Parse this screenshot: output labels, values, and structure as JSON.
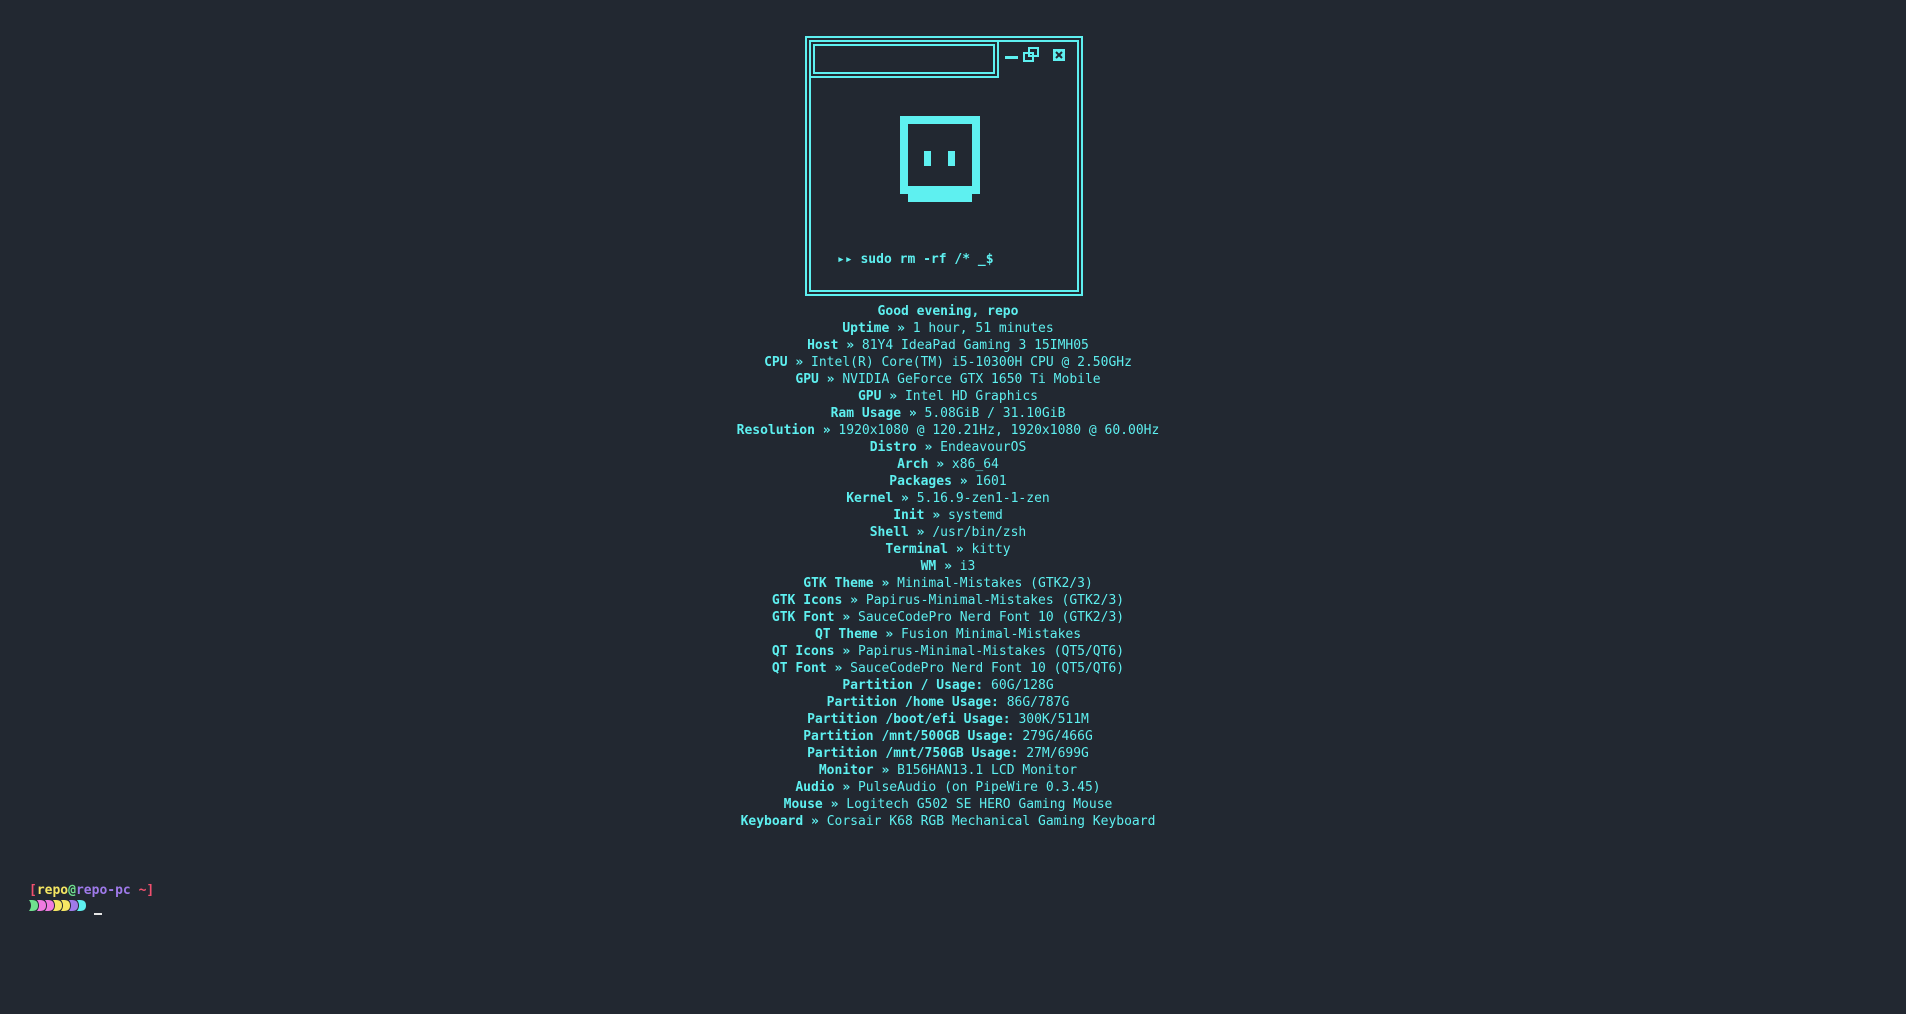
{
  "logo": {
    "command": "▸▸ sudo rm -rf /* _$"
  },
  "greeting": "Good evening, repo",
  "info": [
    {
      "key": "Uptime",
      "sep": " » ",
      "value": "1 hour, 51 minutes"
    },
    {
      "key": "Host",
      "sep": " » ",
      "value": "81Y4 IdeaPad Gaming 3 15IMH05"
    },
    {
      "key": "CPU",
      "sep": " » ",
      "value": "Intel(R) Core(TM) i5-10300H CPU @ 2.50GHz"
    },
    {
      "key": "GPU",
      "sep": " » ",
      "value": "NVIDIA GeForce GTX 1650 Ti Mobile"
    },
    {
      "key": "GPU",
      "sep": " » ",
      "value": "Intel HD Graphics"
    },
    {
      "key": "Ram Usage",
      "sep": " » ",
      "value": "5.08GiB / 31.10GiB"
    },
    {
      "key": "Resolution",
      "sep": " » ",
      "value": "1920x1080 @ 120.21Hz, 1920x1080 @ 60.00Hz"
    },
    {
      "key": "Distro",
      "sep": " » ",
      "value": "EndeavourOS"
    },
    {
      "key": "Arch",
      "sep": " » ",
      "value": "x86_64"
    },
    {
      "key": "Packages",
      "sep": " » ",
      "value": "1601"
    },
    {
      "key": "Kernel",
      "sep": " » ",
      "value": "5.16.9-zen1-1-zen"
    },
    {
      "key": "Init",
      "sep": " » ",
      "value": "systemd"
    },
    {
      "key": "Shell",
      "sep": " » ",
      "value": "/usr/bin/zsh"
    },
    {
      "key": "Terminal",
      "sep": " » ",
      "value": "kitty"
    },
    {
      "key": "WM",
      "sep": " » ",
      "value": "i3"
    },
    {
      "key": "GTK Theme",
      "sep": " » ",
      "value": "Minimal-Mistakes (GTK2/3)"
    },
    {
      "key": "GTK Icons",
      "sep": " » ",
      "value": "Papirus-Minimal-Mistakes (GTK2/3)"
    },
    {
      "key": "GTK Font",
      "sep": " » ",
      "value": "SauceCodePro Nerd Font 10 (GTK2/3)"
    },
    {
      "key": "QT Theme",
      "sep": " » ",
      "value": "Fusion Minimal-Mistakes"
    },
    {
      "key": "QT Icons",
      "sep": " » ",
      "value": "Papirus-Minimal-Mistakes (QT5/QT6)"
    },
    {
      "key": "QT Font",
      "sep": " » ",
      "value": "SauceCodePro Nerd Font 10 (QT5/QT6)"
    },
    {
      "key": "Partition / Usage:",
      "sep": " ",
      "value": "60G/128G"
    },
    {
      "key": "Partition /home Usage:",
      "sep": " ",
      "value": "86G/787G"
    },
    {
      "key": "Partition /boot/efi Usage:",
      "sep": " ",
      "value": "300K/511M"
    },
    {
      "key": "Partition /mnt/500GB Usage:",
      "sep": " ",
      "value": "279G/466G"
    },
    {
      "key": "Partition /mnt/750GB Usage:",
      "sep": " ",
      "value": "27M/699G"
    },
    {
      "key": "Monitor",
      "sep": " » ",
      "value": "B156HAN13.1 LCD Monitor"
    },
    {
      "key": "Audio",
      "sep": " » ",
      "value": "PulseAudio (on PipeWire 0.3.45)"
    },
    {
      "key": "Mouse",
      "sep": " » ",
      "value": "Logitech G502 SE HERO Gaming Mouse"
    },
    {
      "key": "Keyboard",
      "sep": " » ",
      "value": "Corsair K68 RGB Mechanical Gaming Keyboard"
    }
  ],
  "prompt": {
    "open_bracket": "[",
    "user": "repo",
    "at": "@",
    "host": "repo-pc",
    "dir": " ~",
    "close_bracket": "]",
    "chevron_colors": [
      "#6fe08e",
      "#f07ae0",
      "#f07ae0",
      "#f5e663",
      "#f5e663",
      "#9f7aea",
      "#5ef0f0"
    ]
  },
  "colors": {
    "background": "#222831",
    "accent": "#5ef0f0"
  }
}
